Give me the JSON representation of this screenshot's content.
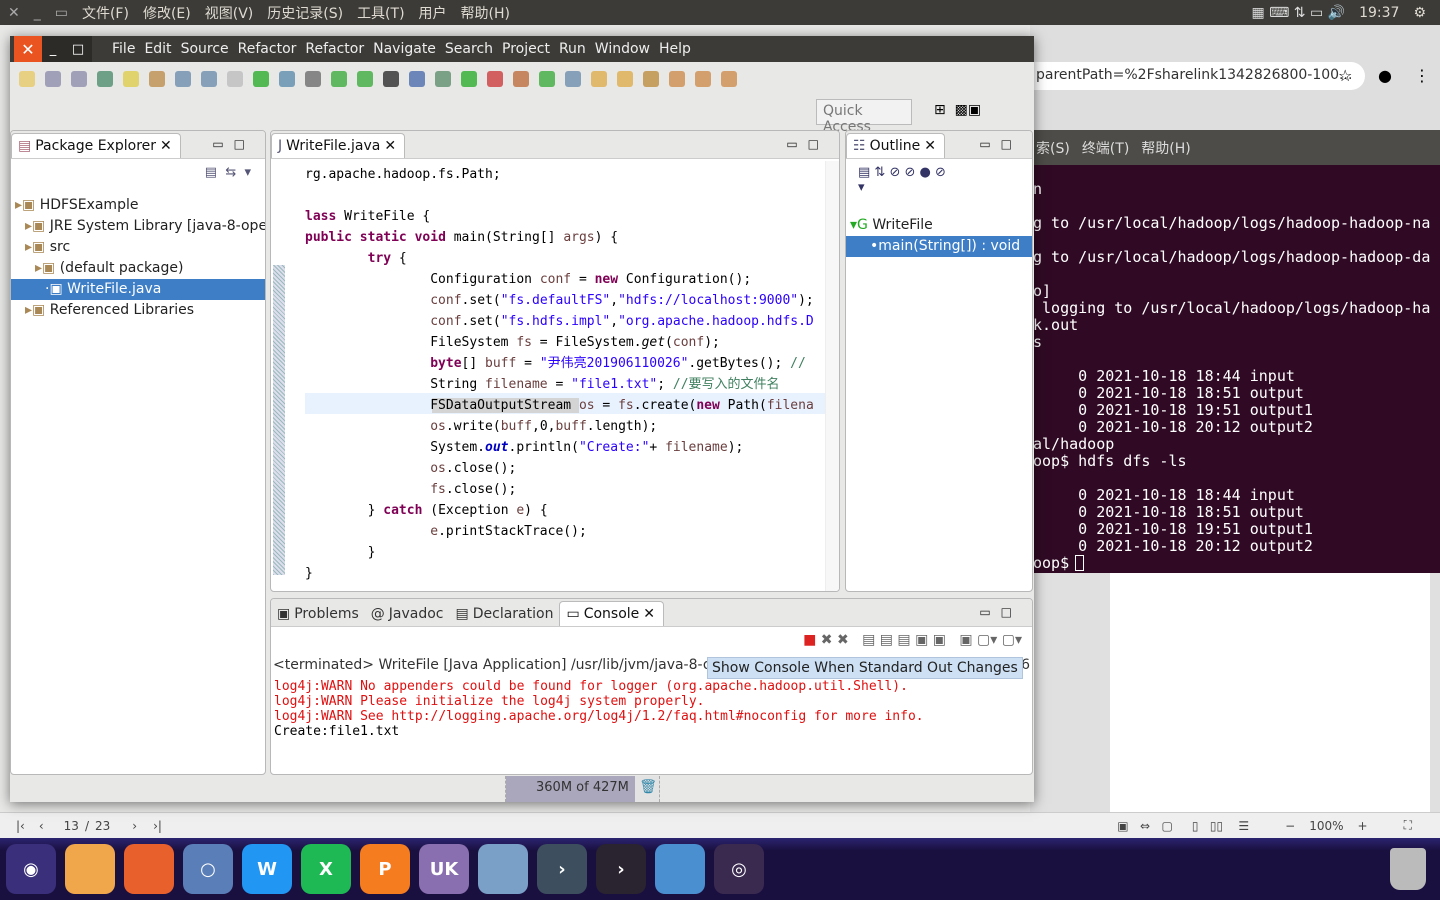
{
  "topbar": {
    "menus": [
      "文件(F)",
      "修改(E)",
      "视图(V)",
      "历史记录(S)",
      "工具(T)",
      "用户",
      "帮助(H)"
    ],
    "time": "19:37"
  },
  "browser": {
    "url": "parentPath=%2Fsharelink1342826800-100..."
  },
  "terminal": {
    "menus": [
      "索(S)",
      "终端(T)",
      "帮助(H)"
    ],
    "lines": [
      "n",
      "",
      "g to /usr/local/hadoop/logs/hadoop-hadoop-na",
      "",
      "g to /usr/local/hadoop/logs/hadoop-hadoop-da",
      "",
      "o]",
      " logging to /usr/local/hadoop/logs/hadoop-ha",
      "k.out",
      "s",
      "",
      "     0 2021-10-18 18:44 input",
      "     0 2021-10-18 18:51 output",
      "     0 2021-10-18 19:51 output1",
      "     0 2021-10-18 20:12 output2",
      "al/hadoop",
      "oop$ hdfs dfs -ls",
      "",
      "     0 2021-10-18 18:44 input",
      "     0 2021-10-18 18:51 output",
      "     0 2021-10-18 19:51 output1",
      "     0 2021-10-18 20:12 output2",
      "oop$ "
    ]
  },
  "eclipse": {
    "menus": [
      "File",
      "Edit",
      "Source",
      "Refactor",
      "Refactor",
      "Navigate",
      "Search",
      "Project",
      "Run",
      "Window",
      "Help"
    ],
    "quick_access": "Quick Access",
    "package_explorer": {
      "title": "Package Explorer",
      "items": [
        {
          "label": "HDFSExample",
          "indent": 0
        },
        {
          "label": "JRE System Library [java-8-openjdk]",
          "indent": 1
        },
        {
          "label": "src",
          "indent": 1
        },
        {
          "label": "(default package)",
          "indent": 2
        },
        {
          "label": "WriteFile.java",
          "indent": 3,
          "selected": true
        },
        {
          "label": "Referenced Libraries",
          "indent": 1
        }
      ]
    },
    "editor": {
      "tab": "WriteFile.java",
      "code": [
        [
          [
            "rg.apache.hadoop.fs.Path;",
            ""
          ]
        ],
        [],
        [
          [
            "lass",
            "kw"
          ],
          [
            " WriteFile {",
            ""
          ]
        ],
        [
          [
            "public",
            "kw"
          ],
          [
            " ",
            ""
          ],
          [
            "static",
            "kw"
          ],
          [
            " ",
            ""
          ],
          [
            "void",
            "kw"
          ],
          [
            " main(String[] ",
            ""
          ],
          [
            "args",
            "var"
          ],
          [
            ") {",
            ""
          ]
        ],
        [
          [
            "        ",
            ""
          ],
          [
            "try",
            "kw"
          ],
          [
            " {",
            ""
          ]
        ],
        [
          [
            "                Configuration ",
            ""
          ],
          [
            "conf",
            "var"
          ],
          [
            " = ",
            ""
          ],
          [
            "new",
            "kw"
          ],
          [
            " Configuration();",
            ""
          ]
        ],
        [
          [
            "                ",
            ""
          ],
          [
            "conf",
            "var"
          ],
          [
            ".set(",
            ""
          ],
          [
            "\"fs.defaultFS\"",
            "str"
          ],
          [
            ",",
            ""
          ],
          [
            "\"hdfs://localhost:9000\"",
            "str"
          ],
          [
            ");",
            ""
          ]
        ],
        [
          [
            "                ",
            ""
          ],
          [
            "conf",
            "var"
          ],
          [
            ".set(",
            ""
          ],
          [
            "\"fs.hdfs.impl\"",
            "str"
          ],
          [
            ",",
            ""
          ],
          [
            "\"org.apache.hadoop.hdfs.D",
            "str"
          ]
        ],
        [
          [
            "                FileSystem ",
            ""
          ],
          [
            "fs",
            "var"
          ],
          [
            " = FileSystem.",
            ""
          ],
          [
            "get",
            "it"
          ],
          [
            "(",
            ""
          ],
          [
            "conf",
            "var"
          ],
          [
            ");",
            ""
          ]
        ],
        [
          [
            "                ",
            ""
          ],
          [
            "byte",
            "kw"
          ],
          [
            "[] ",
            ""
          ],
          [
            "buff",
            "var"
          ],
          [
            " = ",
            ""
          ],
          [
            "\"尹伟亮201906110026\"",
            "str"
          ],
          [
            ".getBytes(); ",
            ""
          ],
          [
            "//",
            "cm"
          ]
        ],
        [
          [
            "                String ",
            ""
          ],
          [
            "filename",
            "var"
          ],
          [
            " = ",
            ""
          ],
          [
            "\"file1.txt\"",
            "str"
          ],
          [
            "; ",
            ""
          ],
          [
            "//要写入的文件名",
            "cm"
          ]
        ],
        [
          [
            "                FSDataOutputStream ",
            ""
          ],
          [
            "os",
            "var"
          ],
          [
            " = ",
            ""
          ],
          [
            "fs",
            "var"
          ],
          [
            ".create(",
            ""
          ],
          [
            "new",
            "kw"
          ],
          [
            " Path(",
            ""
          ],
          [
            "filena",
            "var"
          ]
        ],
        [
          [
            "                ",
            ""
          ],
          [
            "os",
            "var"
          ],
          [
            ".write(",
            ""
          ],
          [
            "buff",
            "var"
          ],
          [
            ",0,",
            ""
          ],
          [
            "buff",
            "var"
          ],
          [
            ".length);",
            ""
          ]
        ],
        [
          [
            "                System.",
            ""
          ],
          [
            "out",
            "fld"
          ],
          [
            ".println(",
            ""
          ],
          [
            "\"Create:\"",
            "str"
          ],
          [
            "+ ",
            ""
          ],
          [
            "filename",
            "var"
          ],
          [
            ");",
            ""
          ]
        ],
        [
          [
            "                ",
            ""
          ],
          [
            "os",
            "var"
          ],
          [
            ".close();",
            ""
          ]
        ],
        [
          [
            "                ",
            ""
          ],
          [
            "fs",
            "var"
          ],
          [
            ".close();",
            ""
          ]
        ],
        [
          [
            "        } ",
            ""
          ],
          [
            "catch",
            "kw"
          ],
          [
            " (Exception ",
            ""
          ],
          [
            "e",
            "var"
          ],
          [
            ") {",
            ""
          ]
        ],
        [
          [
            "                ",
            ""
          ],
          [
            "e",
            "var"
          ],
          [
            ".printStackTrace();",
            ""
          ]
        ],
        [
          [
            "        }",
            ""
          ]
        ],
        [
          [
            "}",
            ""
          ]
        ]
      ]
    },
    "outline": {
      "title": "Outline",
      "class": "WriteFile",
      "method": "main(String[]) : void"
    },
    "bottom_tabs": [
      "Problems",
      "Javadoc",
      "Declaration",
      "Console"
    ],
    "console": {
      "header": "<terminated> WriteFile [Java Application] /usr/lib/jvm/java-8-op",
      "header_tail": "36",
      "tooltip": "Show Console When Standard Out Changes",
      "lines": [
        {
          "text": "log4j:WARN No appenders could be found for logger (org.apache.hadoop.util.Shell).",
          "err": true
        },
        {
          "text": "log4j:WARN Please initialize the log4j system properly.",
          "err": true
        },
        {
          "text": "log4j:WARN See http://logging.apache.org/log4j/1.2/faq.html#noconfig for more info.",
          "err": true
        },
        {
          "text": "Create:file1.txt",
          "err": false
        }
      ]
    },
    "heap": "360M of 427M",
    "heap_fraction": 0.843
  },
  "docviewer": {
    "page": "13",
    "sep": "/",
    "total": "23",
    "zoom": "100%"
  },
  "dock": [
    {
      "name": "ubuntu",
      "color": "#3a2f7a",
      "label": "◉"
    },
    {
      "name": "files",
      "color": "#f0a64a",
      "label": ""
    },
    {
      "name": "firefox",
      "color": "#e8602c",
      "label": ""
    },
    {
      "name": "chromium",
      "color": "#5a7fb8",
      "label": "○"
    },
    {
      "name": "word",
      "color": "#2196f3",
      "label": "W"
    },
    {
      "name": "excel",
      "color": "#1eb955",
      "label": "X"
    },
    {
      "name": "powerpoint",
      "color": "#f57c1f",
      "label": "P"
    },
    {
      "name": "uk",
      "color": "#8a6fb0",
      "label": "UK"
    },
    {
      "name": "store",
      "color": "#7aa0c8",
      "label": ""
    },
    {
      "name": "vscode",
      "color": "#3d4f5f",
      "label": "›"
    },
    {
      "name": "terminal",
      "color": "#2a2330",
      "label": "›"
    },
    {
      "name": "app-grid",
      "color": "#4a8fd0",
      "label": ""
    },
    {
      "name": "disk",
      "color": "#3a2a50",
      "label": "◎"
    }
  ]
}
